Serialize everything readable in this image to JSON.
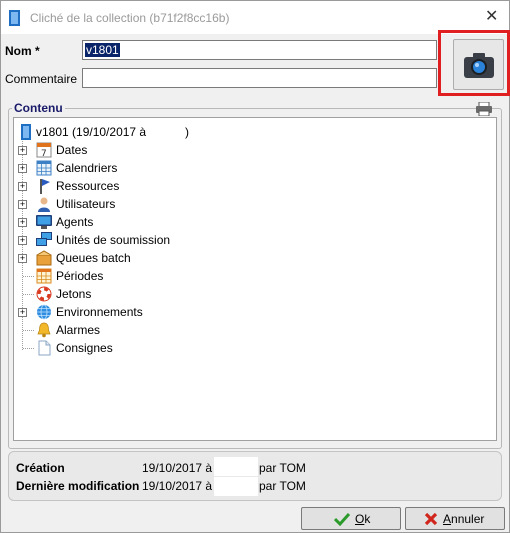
{
  "window": {
    "title": "Cliché de la collection (b71f2f8cc16b)",
    "close_glyph": "✕"
  },
  "form": {
    "name_label": "Nom *",
    "name_value": "v1801",
    "comment_label": "Commentaire",
    "comment_value": ""
  },
  "content": {
    "group_label": "Contenu",
    "root_label": "v1801 (19/10/2017 à",
    "root_suffix": ")",
    "items": [
      {
        "label": "Dates",
        "icon": "calendar-day-icon",
        "expandable": true
      },
      {
        "label": "Calendriers",
        "icon": "calendar-grid-icon",
        "expandable": true
      },
      {
        "label": "Ressources",
        "icon": "flag-icon",
        "expandable": true
      },
      {
        "label": "Utilisateurs",
        "icon": "user-icon",
        "expandable": true
      },
      {
        "label": "Agents",
        "icon": "monitor-icon",
        "expandable": true
      },
      {
        "label": "Unités de soumission",
        "icon": "computers-icon",
        "expandable": true
      },
      {
        "label": "Queues batch",
        "icon": "queue-icon",
        "expandable": true
      },
      {
        "label": "Périodes",
        "icon": "calendar-period-icon",
        "expandable": false
      },
      {
        "label": "Jetons",
        "icon": "lifebuoy-icon",
        "expandable": false
      },
      {
        "label": "Environnements",
        "icon": "globe-icon",
        "expandable": true
      },
      {
        "label": "Alarmes",
        "icon": "bell-icon",
        "expandable": false
      },
      {
        "label": "Consignes",
        "icon": "document-icon",
        "expandable": false
      }
    ]
  },
  "info": {
    "creation_label": "Création",
    "creation_date": "19/10/2017 à",
    "creation_by": "par TOM",
    "modified_label": "Dernière modification",
    "modified_date": "19/10/2017 à",
    "modified_by": "par TOM"
  },
  "buttons": {
    "ok_mnemonic": "O",
    "ok_rest": "k",
    "cancel_mnemonic": "A",
    "cancel_rest": "nnuler"
  },
  "colors": {
    "highlight": "#e02020",
    "camera": "#2b82d9",
    "selection": "#0a246a"
  }
}
